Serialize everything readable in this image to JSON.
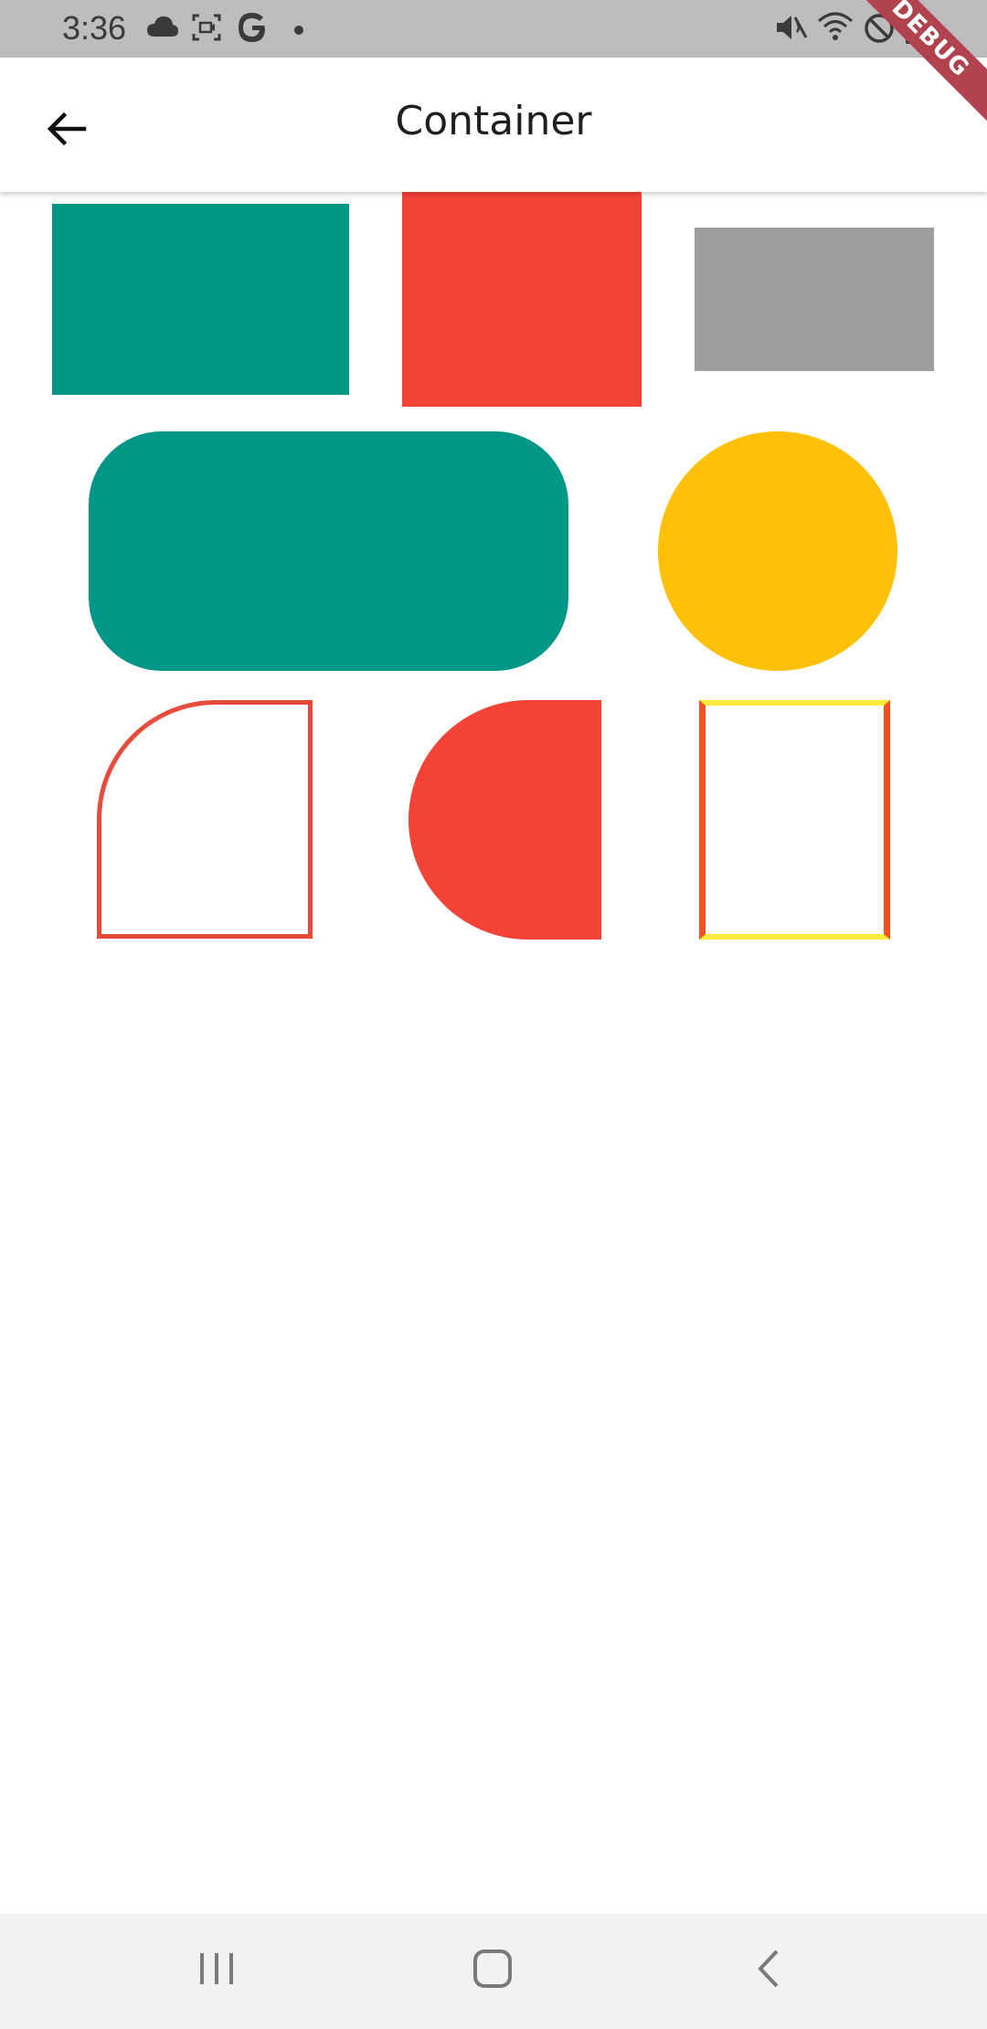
{
  "status_bar": {
    "time": "3:36",
    "left_icons": [
      "cloud-icon",
      "screen-record-icon",
      "google-icon",
      "dot-icon"
    ],
    "right_icons": [
      "mute-icon",
      "wifi-icon",
      "do-not-disturb-icon",
      "battery-icon"
    ]
  },
  "app_bar": {
    "title": "Container",
    "back_icon": "arrow-back-icon"
  },
  "debug_banner": "DEBUG",
  "colors": {
    "teal": "#009688",
    "red": "#f44336",
    "grey": "#9e9e9e",
    "amber": "#ffc107",
    "border_red": "#e84a3c",
    "yellow": "#ffeb3b",
    "deep_orange": "#f4511e"
  },
  "nav_bar": {
    "items": [
      "recent-apps-icon",
      "home-icon",
      "back-icon"
    ]
  }
}
